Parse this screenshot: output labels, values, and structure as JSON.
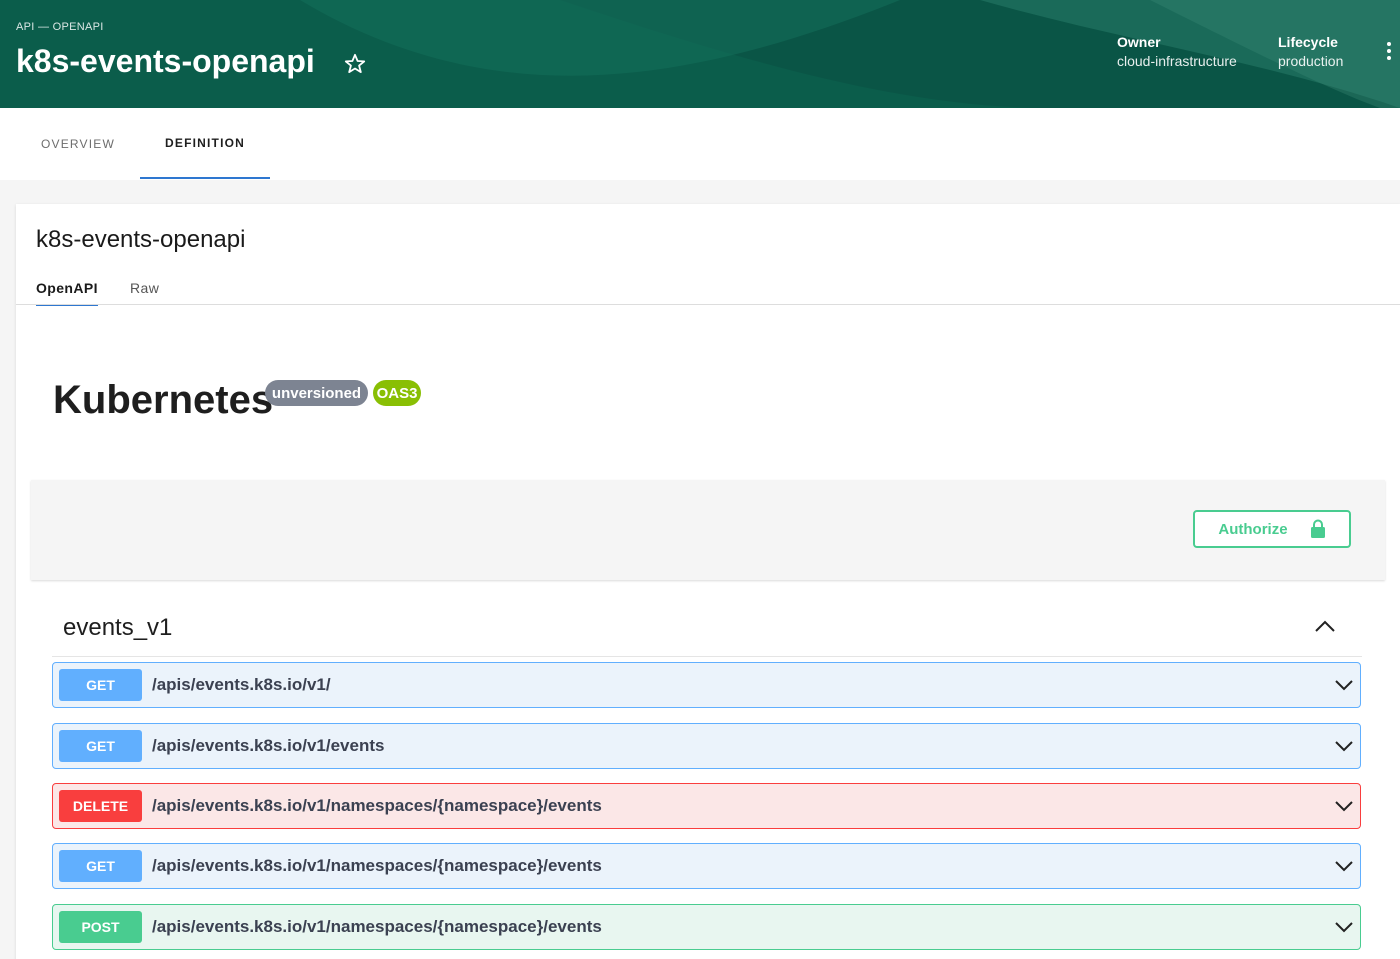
{
  "header": {
    "breadcrumb": "API — OPENAPI",
    "title": "k8s-events-openapi",
    "owner_label": "Owner",
    "owner_value": "cloud-infrastructure",
    "lifecycle_label": "Lifecycle",
    "lifecycle_value": "production"
  },
  "tabs": [
    {
      "label": "OVERVIEW"
    },
    {
      "label": "DEFINITION"
    }
  ],
  "card": {
    "title": "k8s-events-openapi",
    "subtabs": [
      {
        "label": "OpenAPI"
      },
      {
        "label": "Raw"
      }
    ]
  },
  "api": {
    "title": "Kubernetes",
    "version_badge": "unversioned",
    "spec_badge": "OAS3"
  },
  "authorize": {
    "label": "Authorize"
  },
  "tag": {
    "name": "events_v1"
  },
  "operations": [
    {
      "method": "GET",
      "path": "/apis/events.k8s.io/v1/"
    },
    {
      "method": "GET",
      "path": "/apis/events.k8s.io/v1/events"
    },
    {
      "method": "DELETE",
      "path": "/apis/events.k8s.io/v1/namespaces/{namespace}/events"
    },
    {
      "method": "GET",
      "path": "/apis/events.k8s.io/v1/namespaces/{namespace}/events"
    },
    {
      "method": "POST",
      "path": "/apis/events.k8s.io/v1/namespaces/{namespace}/events"
    }
  ],
  "colors": {
    "header_bg": "#0b5d4b",
    "tab_indicator": "#2e77d0",
    "get": "#61affe",
    "delete": "#f93e3e",
    "post": "#49cc90",
    "oas_badge": "#89bf04",
    "version_badge": "#7d8492"
  },
  "icons": {
    "favorite": "star-icon",
    "menu": "more-vertical-icon",
    "lock": "lock-icon",
    "collapse": "chevron-up-icon",
    "expand": "chevron-down-icon"
  }
}
